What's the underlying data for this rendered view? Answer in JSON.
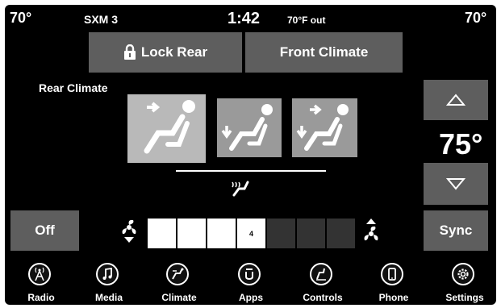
{
  "status_bar": {
    "left_temp": "70°",
    "source": "SXM 3",
    "time": "1:42",
    "outside_temp": "70°F out",
    "right_temp": "70°"
  },
  "top_buttons": {
    "lock_rear": "Lock Rear",
    "front_climate": "Front Climate"
  },
  "rear_climate": {
    "title": "Rear Climate",
    "modes": [
      {
        "name": "panel",
        "selected": true
      },
      {
        "name": "floor",
        "selected": false
      },
      {
        "name": "bi-level",
        "selected": false
      }
    ],
    "set_temp": "75°"
  },
  "fan": {
    "off_label": "Off",
    "level": "4",
    "level_value": 4,
    "max_level": 8
  },
  "sync_label": "Sync",
  "nav": [
    {
      "label": "Radio",
      "icon": "radio-icon"
    },
    {
      "label": "Media",
      "icon": "music-note-icon"
    },
    {
      "label": "Climate",
      "icon": "climate-icon"
    },
    {
      "label": "Apps",
      "icon": "apps-icon"
    },
    {
      "label": "Controls",
      "icon": "controls-icon"
    },
    {
      "label": "Phone",
      "icon": "phone-icon"
    },
    {
      "label": "Settings",
      "icon": "gear-icon"
    }
  ],
  "colors": {
    "background": "#000000",
    "button": "#5e5e5e",
    "mode_button": "#9a9a9a",
    "mode_selected": "#b9b9b9",
    "fan_on": "#ffffff",
    "fan_off": "#333333"
  }
}
